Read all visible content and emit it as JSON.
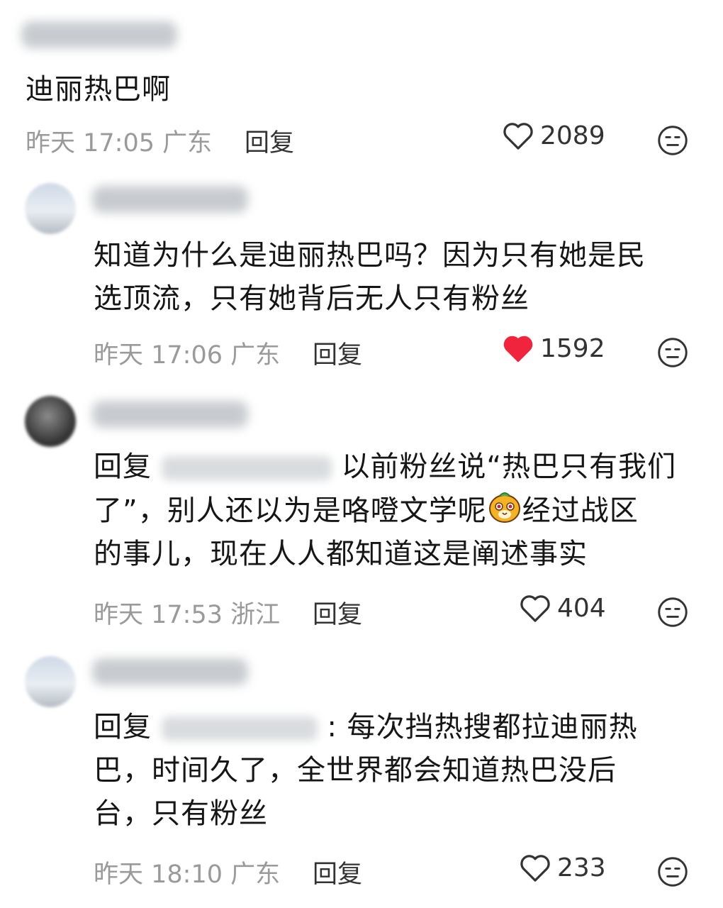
{
  "comments": [
    {
      "text": "迪丽热巴啊",
      "time": "昨天 17:05",
      "location": "广东",
      "reply_label": "回复",
      "likes": "2089",
      "liked": false
    },
    {
      "line1": "知道为什么是迪丽热巴吗？因为只有她是民",
      "line2": "选顶流，只有她背后无人只有粉丝",
      "time": "昨天 17:06",
      "location": "广东",
      "reply_label": "回复",
      "likes": "1592",
      "liked": true
    },
    {
      "reply_prefix": "回复",
      "line1": "以前粉丝说“热巴只有我们",
      "line2a": "了”，别人还以为是咯噔文学呢",
      "line2b": "经过战区",
      "line3": "的事儿，现在人人都知道这是阐述事实",
      "time": "昨天 17:53",
      "location": "浙江",
      "reply_label": "回复",
      "likes": "404",
      "liked": false
    },
    {
      "reply_prefix": "回复",
      "line1": ": 每次挡热搜都拉迪丽热",
      "line2": "巴，时间久了，全世界都会知道热巴没后",
      "line3": "台，只有粉丝",
      "time": "昨天 18:10",
      "location": "广东",
      "reply_label": "回复",
      "likes": "233",
      "liked": false
    }
  ],
  "colors": {
    "liked_heart": "#f0243c",
    "meta_gray": "#9a9a9a",
    "text": "#161616"
  },
  "icons": [
    "heart-outline-icon",
    "heart-filled-icon",
    "neutral-face-icon",
    "dog-face-emoji"
  ]
}
